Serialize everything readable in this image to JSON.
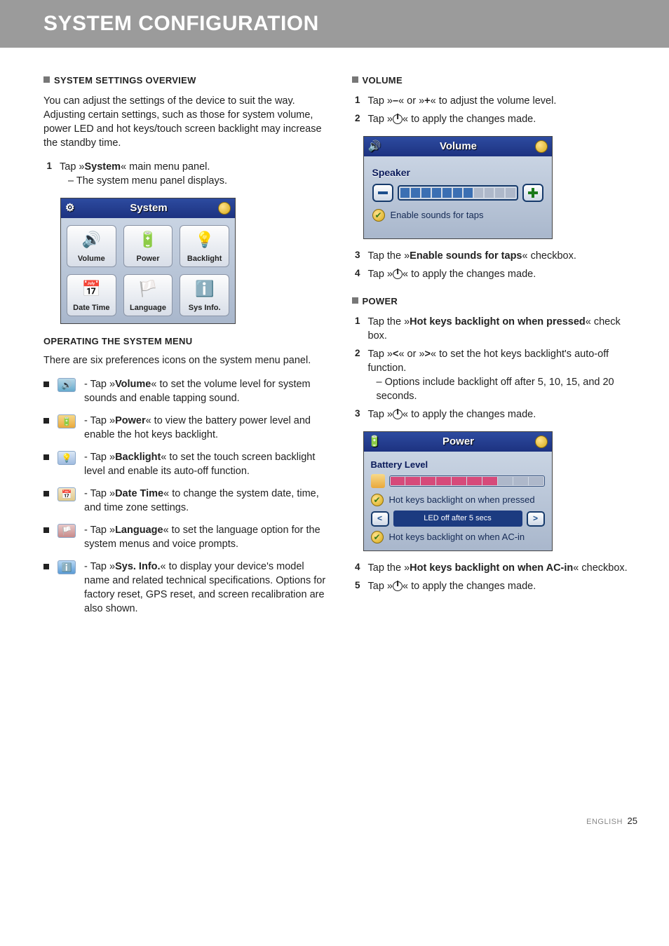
{
  "page_title": "SYSTEM CONFIGURATION",
  "footer": {
    "lang": "ENGLISH",
    "page_num": "25"
  },
  "left": {
    "h_overview": "SYSTEM SETTINGS OVERVIEW",
    "overview_para": "You can adjust the settings of the device to suit the way. Adjusting certain settings, such as those for system volume, power LED and hot keys/touch screen backlight may increase the standby time.",
    "step1_pre": "Tap »",
    "step1_bold": "System",
    "step1_post": "« main menu panel.",
    "step1_sub": "– The system menu panel displays.",
    "sys_shot": {
      "title": "System",
      "buttons": [
        "Volume",
        "Power",
        "Backlight",
        "Date Time",
        "Language",
        "Sys Info."
      ]
    },
    "h_operating": "OPERATING THE SYSTEM MENU",
    "operating_para": "There are six preferences icons on the system menu panel.",
    "items": {
      "vol": {
        "pre": "- Tap »",
        "b": "Volume",
        "post": "« to set the volume level for system sounds and enable tapping sound."
      },
      "pow": {
        "pre": "- Tap »",
        "b": "Power",
        "post": "« to view the battery power level and enable the hot keys backlight."
      },
      "bl": {
        "pre": "- Tap »",
        "b": "Backlight",
        "post": "« to set the touch screen backlight level and enable its auto-off function."
      },
      "dt": {
        "pre": "- Tap »",
        "b": "Date Time",
        "post": "« to change the system date, time, and time zone settings."
      },
      "lang": {
        "pre": "- Tap »",
        "b": "Language",
        "post": "« to set the language option for the system menus and voice prompts."
      },
      "info": {
        "pre": "- Tap »",
        "b": "Sys. Info.",
        "post": "« to display your device's model name and related technical specifications. Options for factory reset, GPS reset, and screen recalibration are also shown."
      }
    }
  },
  "right": {
    "h_volume": "VOLUME",
    "vol_s1_pre": "Tap »",
    "vol_s1_m": "–",
    "vol_s1_mid": "« or »",
    "vol_s1_p": "+",
    "vol_s1_post": "« to adjust the volume level.",
    "vol_s2_pre": "Tap »",
    "vol_s2_post": "« to apply the changes made.",
    "vol_shot": {
      "title": "Volume",
      "speaker": "Speaker",
      "chk": "Enable sounds for taps"
    },
    "vol_s3_pre": "Tap the »",
    "vol_s3_b": "Enable sounds for taps",
    "vol_s3_post": "« checkbox.",
    "vol_s4_pre": "Tap »",
    "vol_s4_post": "« to apply the changes made.",
    "h_power": "POWER",
    "pw_s1_pre": "Tap the »",
    "pw_s1_b": "Hot keys backlight on when pressed",
    "pw_s1_post": "« check box.",
    "pw_s2_pre": "Tap »",
    "pw_s2_l": "<",
    "pw_s2_mid": "« or »",
    "pw_s2_r": ">",
    "pw_s2_post": "« to set the hot keys backlight's auto-off function.",
    "pw_s2_sub": "– Options include backlight off after 5, 10, 15, and 20 seconds.",
    "pw_s3_pre": "Tap »",
    "pw_s3_post": "« to apply the changes made.",
    "pow_shot": {
      "title": "Power",
      "batt": "Battery Level",
      "chk1": "Hot keys backlight on when pressed",
      "led": "LED off after 5 secs",
      "chk2": "Hot keys backlight on when AC-in"
    },
    "pw_s4_pre": "Tap the »",
    "pw_s4_b": "Hot keys backlight on when AC-in",
    "pw_s4_post": "« checkbox.",
    "pw_s5_pre": "Tap »",
    "pw_s5_post": "« to apply the changes made."
  }
}
